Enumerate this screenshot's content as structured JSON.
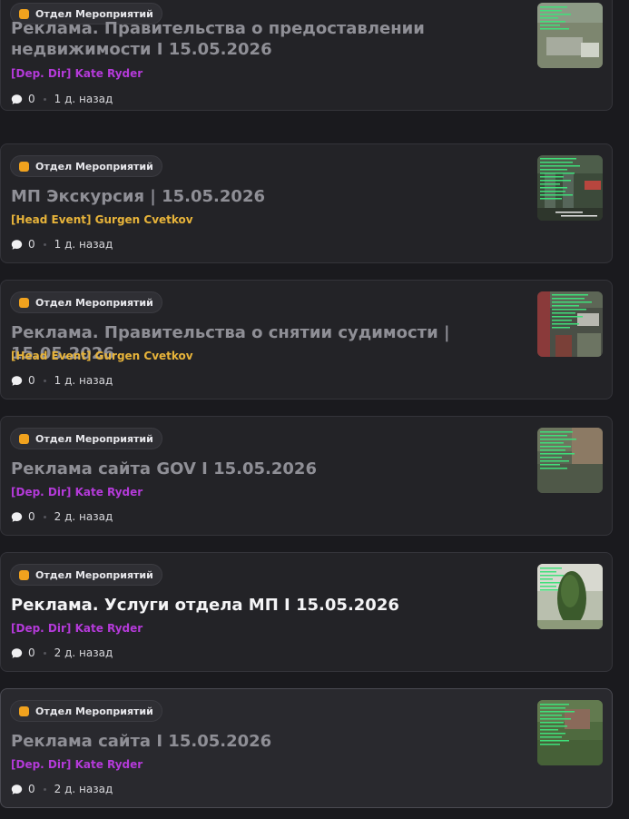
{
  "colors": {
    "tag_icon": "#f0a21e",
    "dep_dir": "#b43ad9",
    "head_event": "#e8b43a",
    "title_dim": "#8f8f96",
    "title_bright": "#f4f4f6"
  },
  "posts": [
    {
      "tag": "Отдел Мероприятий",
      "title": "Реклама. Правительства о предоставлении недвижимости I 15.05.2026",
      "author": "[Dep. Dir] Kate Ryder",
      "comments": "0",
      "time": "1 д. назад",
      "icon": "comment-bubble-icon"
    },
    {
      "tag": "Отдел Мероприятий",
      "title": "МП Экскурсия | 15.05.2026",
      "author": "[Head Event] Gurgen Cvetkov",
      "comments": "0",
      "time": "1 д. назад",
      "icon": "comment-bubble-icon"
    },
    {
      "tag": "Отдел Мероприятий",
      "title": "Реклама. Правительства о снятии судимости | 15.05.2026",
      "author": "[Head Event] Gurgen Cvetkov",
      "comments": "0",
      "time": "1 д. назад",
      "icon": "comment-bubble-icon"
    },
    {
      "tag": "Отдел Мероприятий",
      "title": "Реклама сайта GOV I 15.05.2026",
      "author": "[Dep. Dir] Kate Ryder",
      "comments": "0",
      "time": "2 д. назад",
      "icon": "comment-bubble-icon"
    },
    {
      "tag": "Отдел Мероприятий",
      "title": "Реклама. Услуги отдела МП I 15.05.2026",
      "author": "[Dep. Dir] Kate Ryder",
      "comments": "0",
      "time": "2 д. назад",
      "icon": "comment-bubble-icon"
    },
    {
      "tag": "Отдел Мероприятий",
      "title": "Реклама сайта I 15.05.2026",
      "author": "[Dep. Dir] Kate Ryder",
      "comments": "0",
      "time": "2 д. назад",
      "icon": "comment-bubble-icon"
    }
  ]
}
